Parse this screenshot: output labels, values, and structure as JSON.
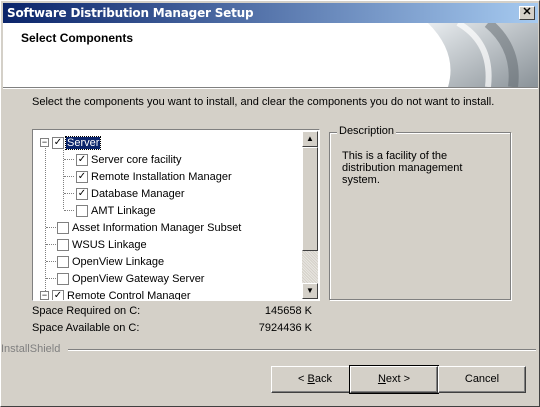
{
  "window": {
    "title": "Software Distribution Manager Setup",
    "close_glyph": "✕"
  },
  "header": {
    "heading": "Select Components"
  },
  "instruction": "Select the components you want to install, and clear the components you do not want to install.",
  "tree": {
    "items": [
      {
        "label": "Server",
        "checked": true,
        "expander": "−",
        "selected": true
      },
      {
        "label": "Server core facility",
        "checked": true
      },
      {
        "label": "Remote Installation Manager",
        "checked": true
      },
      {
        "label": "Database Manager",
        "checked": true
      },
      {
        "label": "AMT Linkage",
        "checked": false
      },
      {
        "label": "Asset Information Manager Subset",
        "checked": false
      },
      {
        "label": "WSUS Linkage",
        "checked": false
      },
      {
        "label": "OpenView Linkage",
        "checked": false
      },
      {
        "label": "OpenView Gateway Server",
        "checked": false
      },
      {
        "label": "Remote Control Manager",
        "checked": true,
        "expander": "−"
      }
    ]
  },
  "description": {
    "legend": "Description",
    "text": "This is a facility of the distribution management system."
  },
  "space": {
    "required_label": "Space Required on  C:",
    "required_value": "145658 K",
    "available_label": "Space Available on  C:",
    "available_value": "7924436 K"
  },
  "footer": {
    "brand": "InstallShield"
  },
  "buttons": {
    "back_prefix": "< ",
    "back_key": "B",
    "back_rest": "ack",
    "next_key": "N",
    "next_rest": "ext >",
    "cancel": "Cancel"
  },
  "icons": {
    "check": "✓",
    "scroll_up": "▲",
    "scroll_down": "▼"
  },
  "colors": {
    "title_start": "#0a246a",
    "title_end": "#a6caf0",
    "selection": "#0a246a"
  }
}
